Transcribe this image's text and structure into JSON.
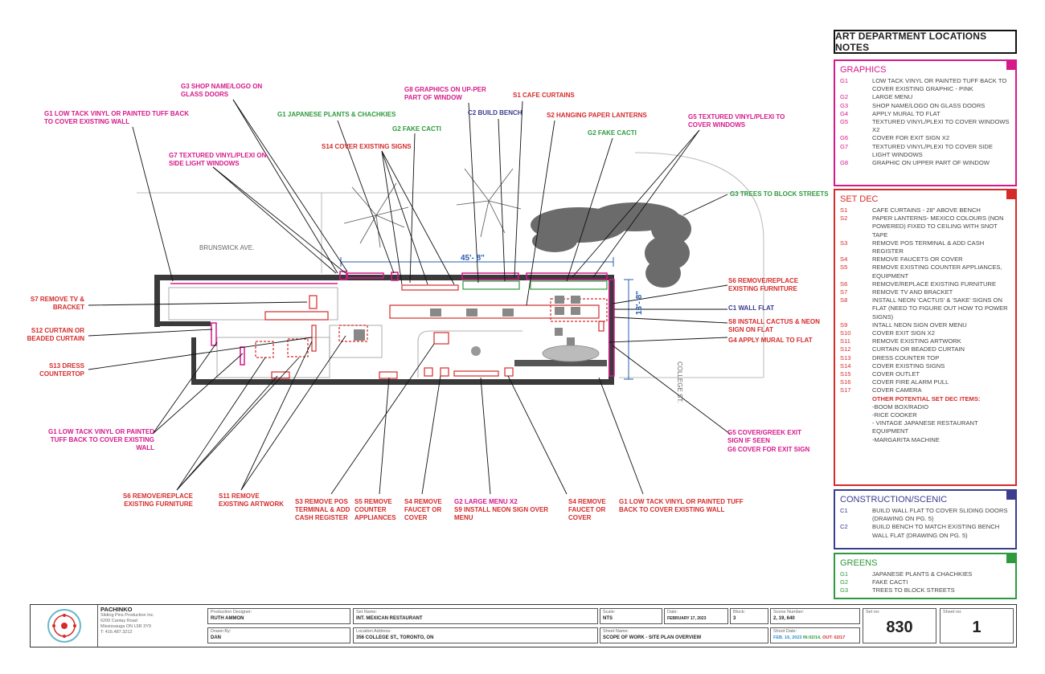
{
  "labels": {
    "g3_shop": "G3 SHOP NAME/LOGO ON GLASS DOORS",
    "g1_top": "G1 LOW TACK VINYL OR PAINTED TUFF BACK TO COVER EXISTING WALL",
    "g1_plants": "G1 JAPANESE PLANTS & CHACHKIES",
    "g8": "G8 GRAPHICS ON UP-PER PART OF WINDOW",
    "s1": "S1 CAFE CURTAINS",
    "c2": "C2 BUILD BENCH",
    "s2": "S2 HANGING PAPER LANTERNS",
    "g2_top_left": "G2 FAKE CACTI",
    "g2_top_right": "G2 FAKE CACTI",
    "g5_top": "G5 TEXTURED VINYL/PLEXI TO COVER WINDOWS",
    "s14": "S14 COVER EXISTING SIGNS",
    "g7": "G7 TEXTURED VINYL/PLEXI ON SIDE LIGHT WINDOWS",
    "g3_trees": "G3 TREES TO BLOCK STREETS",
    "brunswick": "BRUNSWICK AVE.",
    "college": "COLLEGE ST.",
    "dim_width": "45'- 8\"",
    "dim_depth": "13'- 8\"",
    "s6_right": "S6 REMOVE/REPLACE EXISTING FURNITURE",
    "s7": "S7 REMOVE TV & BRACKET",
    "c1": "C1 WALL FLAT",
    "s8": "S8 INSTALL CACTUS & NEON SIGN ON FLAT",
    "s12": "S12 CURTAIN OR BEADED CURTAIN",
    "g4": "G4 APPLY MURAL TO FLAT",
    "s13": "S13 DRESS COUNTERTOP",
    "g1_left": "G1 LOW TACK VINYL OR PAINTED TUFF BACK TO COVER EXISTING WALL",
    "g5_bottom": "G5 COVER/GREEK EXIT SIGN IF SEEN",
    "g6_bottom": "G6 COVER FOR EXIT SIGN",
    "s6_bottom": "S6 REMOVE/REPLACE EXISTING FURNITURE",
    "s11": "S11 REMOVE EXISTING ARTWORK",
    "s3": "S3 REMOVE POS TERMINAL & ADD CASH REGISTER",
    "s5": "S5 REMOVE COUNTER APPLIANCES",
    "s4_a": "S4 REMOVE FAUCET OR COVER",
    "g2_menu": "G2 LARGE MENU X2",
    "s9_menu": "S9 INSTALL NEON SIGN OVER MENU",
    "s4_b": "S4 REMOVE FAUCET OR COVER",
    "g1_bottom": "G1 LOW TACK VINYL OR PAINTED TUFF BACK TO COVER EXISTING WALL"
  },
  "notes": {
    "title": "ART DEPARTMENT LOCATIONS NOTES",
    "graphics": {
      "heading": "GRAPHICS",
      "color": "#d6188a",
      "items": [
        {
          "code": "G1",
          "text": "LOW TACK VINYL OR PAINTED TUFF BACK TO COVER EXISTING GRAPHIC - PINK"
        },
        {
          "code": "G2",
          "text": "LARGE MENU"
        },
        {
          "code": "G3",
          "text": "SHOP NAME/LOGO ON GLASS DOORS"
        },
        {
          "code": "G4",
          "text": "APPLY MURAL TO FLAT"
        },
        {
          "code": "G5",
          "text": "TEXTURED VINYL/PLEXI TO COVER WINDOWS X2"
        },
        {
          "code": "G6",
          "text": "COVER FOR EXIT SIGN X2"
        },
        {
          "code": "G7",
          "text": "TEXTURED VINYL/PLEXI TO COVER SIDE LIGHT WINDOWS"
        },
        {
          "code": "G8",
          "text": "GRAPHIC ON UPPER PART OF WINDOW"
        }
      ]
    },
    "setdec": {
      "heading": "SET DEC",
      "color": "#d62b2b",
      "items": [
        {
          "code": "S1",
          "text": "CAFE CURTAINS - 28\" ABOVE BENCH"
        },
        {
          "code": "S2",
          "text": "PAPER LANTERNS- MEXICO COLOURS (NON POWERED) FIXED TO CEILING WITH SNOT TAPE"
        },
        {
          "code": "S3",
          "text": "REMOVE POS TERMINAL & ADD CASH REGISTER"
        },
        {
          "code": "S4",
          "text": "REMOVE FAUCETS OR COVER"
        },
        {
          "code": "S5",
          "text": "REMOVE EXISTING COUNTER APPLIANCES, EQUIPMENT"
        },
        {
          "code": "S6",
          "text": "REMOVE/REPLACE EXISTING FURNITURE"
        },
        {
          "code": "S7",
          "text": "REMOVE TV AND BRACKET"
        },
        {
          "code": "S8",
          "text": "INSTALL NEON 'CACTUS' & 'SAKE' SIGNS ON FLAT (NEED TO FIGURE OUT HOW TO POWER SIGNS)"
        },
        {
          "code": "S9",
          "text": "INTALL NEON SIGN OVER MENU"
        },
        {
          "code": "S10",
          "text": "COVER EXIT SIGN X2"
        },
        {
          "code": "S11",
          "text": "REMOVE EXISTING ARTWORK"
        },
        {
          "code": "S12",
          "text": "CURTAIN OR BEADED CURTAIN"
        },
        {
          "code": "S13",
          "text": "DRESS COUNTER TOP"
        },
        {
          "code": "S14",
          "text": "COVER EXISTING SIGNS"
        },
        {
          "code": "S15",
          "text": "COVER OUTLET"
        },
        {
          "code": "S16",
          "text": "COVER FIRE ALARM PULL"
        },
        {
          "code": "S17",
          "text": "COVER CAMERA"
        }
      ],
      "extra_heading": "OTHER POTENTIAL SET DEC ITEMS:",
      "extra_items": [
        "-BOOM BOX/RADIO",
        "-RICE COOKER",
        "- VINTAGE JAPANESE RESTAURANT EQUIPMENT",
        "-MARGARITA MACHINE"
      ]
    },
    "construction": {
      "heading": "CONSTRUCTION/SCENIC",
      "color": "#3b3d8f",
      "items": [
        {
          "code": "C1",
          "text": "BUILD WALL FLAT TO COVER SLIDING DOORS (DRAWING ON PG. 5)"
        },
        {
          "code": "C2",
          "text": "BUILD BENCH TO MATCH EXISTING BENCH WALL FLAT (DRAWING ON PG. 5)"
        }
      ]
    },
    "greens": {
      "heading": "GREENS",
      "color": "#2e9a3e",
      "items": [
        {
          "code": "G1",
          "text": "JAPANESE PLANTS & CHACHKIES"
        },
        {
          "code": "G2",
          "text": "FAKE CACTI"
        },
        {
          "code": "G3",
          "text": "TREES TO BLOCK STREETS"
        }
      ]
    }
  },
  "titleblock": {
    "company": "PACHINKO",
    "company_sub": "Sliding Pins Production Inc.",
    "addr1": "6200 Cantay Road",
    "addr2": "Mississauga ON L5R 3Y9",
    "phone": "T: 416.487.3212",
    "pd_label": "Production Designer:",
    "pd_value": "RUTH AMMON",
    "drawn_label": "Drawn By:",
    "drawn_value": "DAN",
    "set_label": "Set Name:",
    "set_value": "INT. MEXICAN RESTAURANT",
    "loc_label": "Location Address:",
    "loc_value": "356 COLLEGE ST., TORONTO, ON",
    "scale_label": "Scale:",
    "scale_value": "NTS",
    "date_label": "Date:",
    "date_value": "FEBRUARY 17, 2023",
    "block_label": "Block:",
    "block_value": "3",
    "scene_label": "Scene Number:",
    "scene_value": "2, 19, 640",
    "sheetname_label": "Sheet Name:",
    "sheetname_value": "SCOPE OF WORK - SITE PLAN OVERVIEW",
    "shoot_label": "Shoot Date:",
    "shoot_date": "FEB. 16, 2023",
    "shoot_in": "IN:02/14,",
    "shoot_out": "OUT: 02/17",
    "setno_label": "Set no:",
    "setno_value": "830",
    "sheetno_label": "Sheet no:",
    "sheetno_value": "1"
  },
  "colors": {
    "graphics": "#d6188a",
    "setdec": "#d62b2b",
    "construction": "#3b3d8f",
    "greens": "#2e9a3e"
  }
}
